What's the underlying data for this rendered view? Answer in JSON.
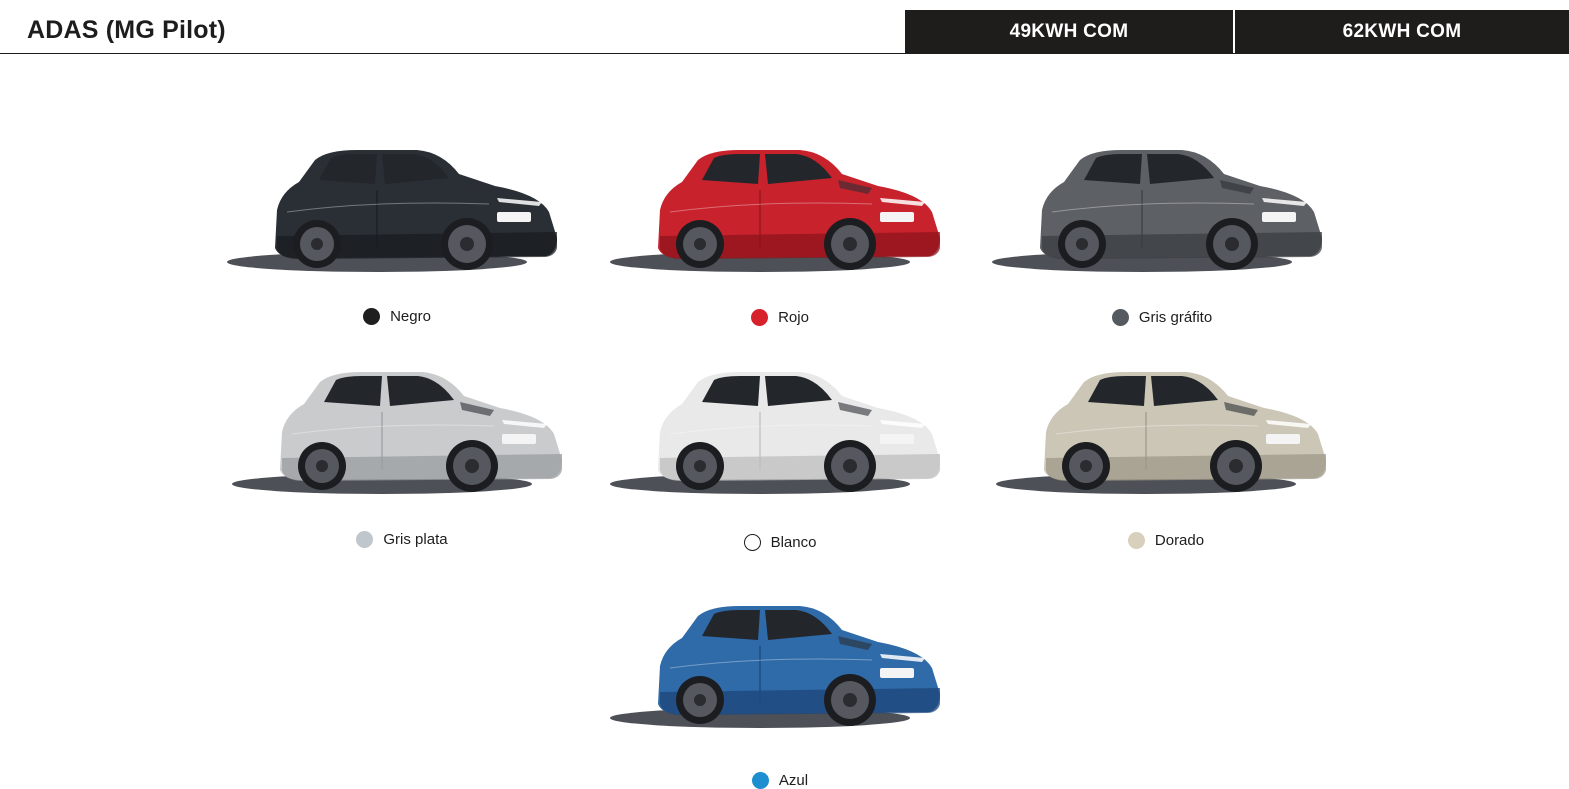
{
  "header": {
    "title": "ADAS (MG Pilot)",
    "versions": [
      "49KWH COM",
      "62KWH COM"
    ]
  },
  "colors": [
    {
      "label": "Negro",
      "swatch": "#1f1f1f",
      "body": "#2a2f36",
      "shade": "#1a1d22",
      "icon": "car-black-icon"
    },
    {
      "label": "Rojo",
      "swatch": "#d7222d",
      "body": "#c8222c",
      "shade": "#8e141b",
      "icon": "car-red-icon"
    },
    {
      "label": "Gris gráfito",
      "swatch": "#545a60",
      "body": "#5d6064",
      "shade": "#3b3e42",
      "icon": "car-graphite-icon"
    },
    {
      "label": "Gris plata",
      "swatch": "#bfc6cc",
      "body": "#c9cbcd",
      "shade": "#9a9da0",
      "icon": "car-silver-icon"
    },
    {
      "label": "Blanco",
      "swatch": "#ffffff",
      "body": "#e9e9e9",
      "shade": "#bdbdbd",
      "icon": "car-white-icon"
    },
    {
      "label": "Dorado",
      "swatch": "#d8d0bd",
      "body": "#cbc6b6",
      "shade": "#9d9888",
      "icon": "car-gold-icon"
    },
    {
      "label": "Azul",
      "swatch": "#1d8fd0",
      "body": "#2f6aa9",
      "shade": "#1d4779",
      "icon": "car-blue-icon"
    }
  ]
}
